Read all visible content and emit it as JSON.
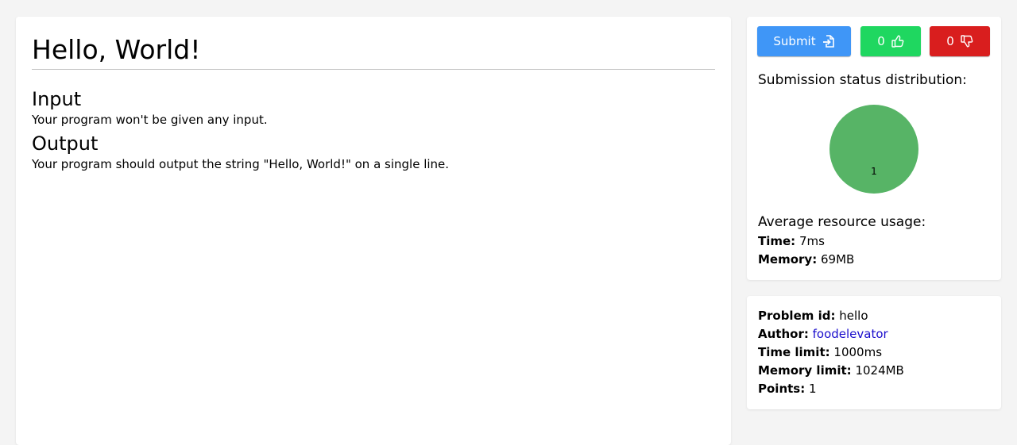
{
  "problem": {
    "title": "Hello, World!",
    "input_heading": "Input",
    "input_text": "Your program won't be given any input.",
    "output_heading": "Output",
    "output_text": "Your program should output the string \"Hello, World!\" on a single line."
  },
  "actions": {
    "submit_label": "Submit",
    "likes": "0",
    "dislikes": "0"
  },
  "distribution": {
    "title": "Submission status distribution:",
    "slices": [
      {
        "value": 1,
        "label": "1",
        "color": "#57b466"
      }
    ]
  },
  "usage": {
    "title": "Average resource usage:",
    "time_label": "Time:",
    "time_value": "7ms",
    "memory_label": "Memory:",
    "memory_value": "69MB"
  },
  "meta": {
    "id_label": "Problem id:",
    "id_value": "hello",
    "author_label": "Author:",
    "author_value": "foodelevator",
    "time_limit_label": "Time limit:",
    "time_limit_value": "1000ms",
    "memory_limit_label": "Memory limit:",
    "memory_limit_value": "1024MB",
    "points_label": "Points:",
    "points_value": "1"
  },
  "colors": {
    "submit": "#3f96f7",
    "like": "#1fd760",
    "dislike": "#d91e1e",
    "link": "#1a0dcc"
  }
}
